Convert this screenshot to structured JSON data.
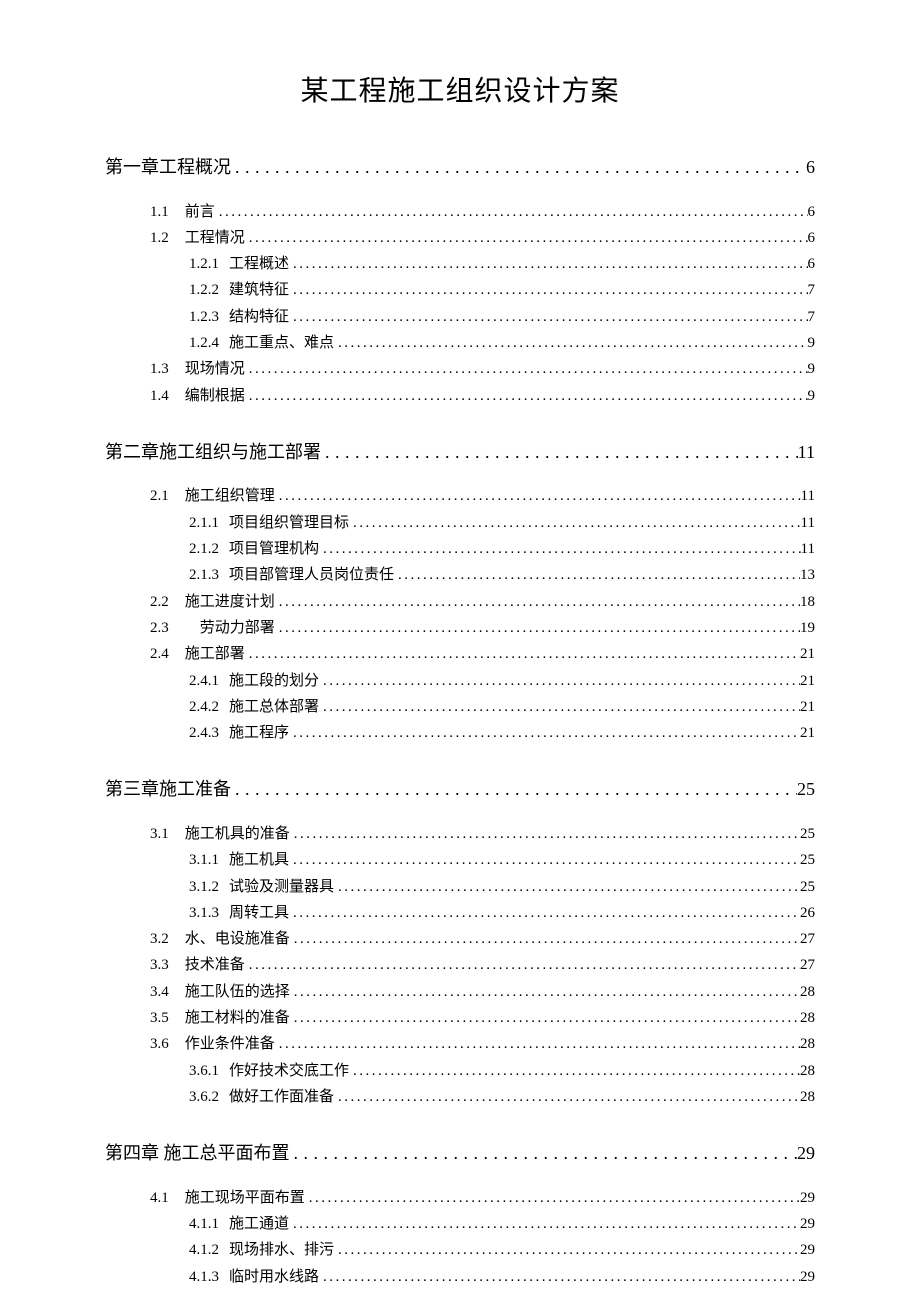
{
  "title": "某工程施工组织设计方案",
  "toc": [
    {
      "level": "chapter",
      "num": "",
      "title": "第一章工程概况",
      "page": "6"
    },
    {
      "level": "l1",
      "num": "1.1",
      "title": "前言",
      "page": "6"
    },
    {
      "level": "l1",
      "num": "1.2",
      "title": "工程情况",
      "page": "6"
    },
    {
      "level": "l2",
      "num": "1.2.1",
      "title": "工程概述",
      "page": "6"
    },
    {
      "level": "l2",
      "num": "1.2.2",
      "title": "建筑特征",
      "page": "7"
    },
    {
      "level": "l2",
      "num": "1.2.3",
      "title": "结构特征",
      "page": "7"
    },
    {
      "level": "l2",
      "num": "1.2.4",
      "title": "施工重点、难点",
      "page": "9"
    },
    {
      "level": "l1",
      "num": "1.3",
      "title": "现场情况",
      "page": "9"
    },
    {
      "level": "l1",
      "num": "1.4",
      "title": "编制根据",
      "page": "9"
    },
    {
      "level": "chapter",
      "num": "",
      "title": "第二章施工组织与施工部署",
      "page": "11"
    },
    {
      "level": "l1",
      "num": "2.1",
      "title": "施工组织管理",
      "page": "11"
    },
    {
      "level": "l2",
      "num": "2.1.1",
      "title": "项目组织管理目标",
      "page": "11"
    },
    {
      "level": "l2",
      "num": "2.1.2",
      "title": "项目管理机构",
      "page": "11"
    },
    {
      "level": "l2",
      "num": "2.1.3",
      "title": "项目部管理人员岗位责任",
      "page": "13"
    },
    {
      "level": "l1",
      "num": "2.2",
      "title": "施工进度计划",
      "page": "18"
    },
    {
      "level": "l1",
      "num": "2.3",
      "title": "　劳动力部署",
      "page": "19"
    },
    {
      "level": "l1",
      "num": "2.4",
      "title": "施工部署",
      "page": "21"
    },
    {
      "level": "l2",
      "num": "2.4.1",
      "title": "施工段的划分",
      "page": "21"
    },
    {
      "level": "l2",
      "num": "2.4.2",
      "title": "施工总体部署",
      "page": "21"
    },
    {
      "level": "l2",
      "num": "2.4.3",
      "title": "施工程序",
      "page": "21"
    },
    {
      "level": "chapter",
      "num": "",
      "title": "第三章施工准备",
      "page": "25"
    },
    {
      "level": "l1",
      "num": "3.1",
      "title": "施工机具的准备",
      "page": "25"
    },
    {
      "level": "l2",
      "num": "3.1.1",
      "title": "施工机具",
      "page": "25"
    },
    {
      "level": "l2",
      "num": "3.1.2",
      "title": "试验及测量器具",
      "page": "25"
    },
    {
      "level": "l2",
      "num": "3.1.3",
      "title": "周转工具",
      "page": "26"
    },
    {
      "level": "l1",
      "num": "3.2",
      "title": "水、电设施准备",
      "page": "27"
    },
    {
      "level": "l1",
      "num": "3.3",
      "title": "技术准备",
      "page": "27"
    },
    {
      "level": "l1",
      "num": "3.4",
      "title": "施工队伍的选择",
      "page": "28"
    },
    {
      "level": "l1",
      "num": "3.5",
      "title": "施工材料的准备",
      "page": "28"
    },
    {
      "level": "l1",
      "num": "3.6",
      "title": "作业条件准备",
      "page": "28"
    },
    {
      "level": "l2",
      "num": "3.6.1",
      "title": "作好技术交底工作",
      "page": "28"
    },
    {
      "level": "l2",
      "num": "3.6.2",
      "title": "做好工作面准备",
      "page": "28"
    },
    {
      "level": "chapter",
      "num": "",
      "title": "第四章  施工总平面布置",
      "page": "29"
    },
    {
      "level": "l1",
      "num": "4.1",
      "title": "施工现场平面布置",
      "page": "29"
    },
    {
      "level": "l2",
      "num": "4.1.1",
      "title": "施工通道",
      "page": "29"
    },
    {
      "level": "l2",
      "num": "4.1.2",
      "title": "现场排水、排污",
      "page": "29"
    },
    {
      "level": "l2",
      "num": "4.1.3",
      "title": "临时用水线路",
      "page": "29"
    }
  ]
}
